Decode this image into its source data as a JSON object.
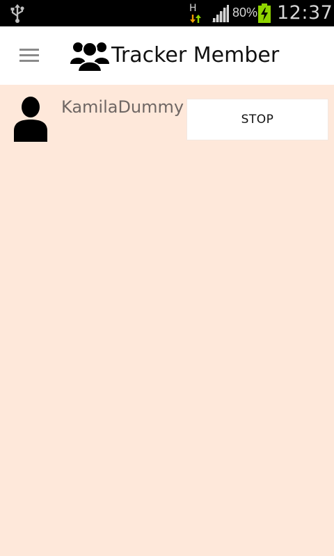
{
  "status_bar": {
    "network_type": "H",
    "battery_percent": "80%",
    "time": "12:37",
    "icons": [
      "usb-icon",
      "network-activity-icon",
      "signal-strength-icon",
      "battery-charging-icon"
    ]
  },
  "app_bar": {
    "title": "Tracker Member",
    "menu_icon": "hamburger-menu-icon",
    "logo_icon": "group-icon"
  },
  "members": [
    {
      "name": "KamilaDummy",
      "avatar_icon": "person-icon",
      "action_label": "STOP"
    }
  ],
  "colors": {
    "background": "#fee8da",
    "app_bar": "#ffffff",
    "status_bar": "#000000",
    "member_name": "#6f6764",
    "battery_accent": "#8fd400",
    "network_arrows": "#f0a000"
  }
}
